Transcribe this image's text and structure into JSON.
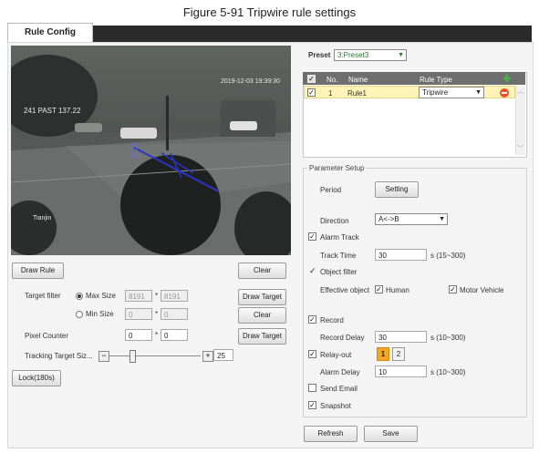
{
  "figure_caption": "Figure 5-91 Tripwire rule settings",
  "tab": {
    "label": "Rule Config"
  },
  "video": {
    "timestamp": "2019-12-03 19:39:30",
    "overlay_text": "241 PAST 137.22",
    "channel_label": "Tianjin"
  },
  "left_controls": {
    "draw_rule": "Draw Rule",
    "clear1": "Clear",
    "target_filter_label": "Target filter",
    "max_size_label": "Max Size",
    "max_w": "8191",
    "max_h": "8191",
    "min_size_label": "Min Size",
    "min_w": "0",
    "min_h": "0",
    "times": "*",
    "draw_target1": "Draw Target",
    "clear2": "Clear",
    "pixel_counter_label": "Pixel Counter",
    "pix_w": "0",
    "pix_h": "0",
    "draw_target2": "Draw Target",
    "tracking_label": "Tracking Target Siz...",
    "tracking_value": "25",
    "tracking_level": 0.25,
    "lock": "Lock(180s)"
  },
  "preset": {
    "label": "Preset",
    "value": "3:Preset3"
  },
  "rule_table": {
    "headers": {
      "no": "No.",
      "name": "Name",
      "type": "Rule Type"
    },
    "rows": [
      {
        "no": "1",
        "name": "Rule1",
        "type": "Tripwire",
        "checked": true
      }
    ]
  },
  "params": {
    "legend": "Parameter Setup",
    "period_label": "Period",
    "setting_btn": "Setting",
    "direction_label": "Direction",
    "direction_value": "A<->B",
    "alarm_track": "Alarm Track",
    "track_time_label": "Track Time",
    "track_time": "30",
    "track_range": "s (15~300)",
    "object_filter": "Object filter",
    "effective_label": "Effective object",
    "human": "Human",
    "motor": "Motor Vehicle",
    "record": "Record",
    "record_delay_label": "Record Delay",
    "record_delay": "30",
    "record_range": "s (10~300)",
    "relay_out": "Relay-out",
    "relay1": "1",
    "relay2": "2",
    "alarm_delay_label": "Alarm Delay",
    "alarm_delay": "10",
    "alarm_range": "s (10~300)",
    "send_email": "Send Email",
    "snapshot": "Snapshot"
  },
  "footer": {
    "refresh": "Refresh",
    "save": "Save"
  },
  "colors": {
    "accent_orange": "#f5a623",
    "tripwire_blue": "#2a35c9",
    "rule_row": "#fff4b8"
  }
}
